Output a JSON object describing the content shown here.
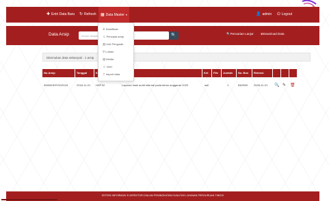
{
  "colors": {
    "brand": "#a31f1f",
    "search_button": "#3a4a5a",
    "delete_icon": "#c0392b"
  },
  "navbar": {
    "entry_label": "Entri Data Baru",
    "refresh_label": "Refresh",
    "master_label": "Data Master",
    "user_label": "admin",
    "logout_label": "Logout"
  },
  "dropdown": {
    "items": [
      {
        "label": "Klasifikasi",
        "icon": "sitemap-icon"
      },
      {
        "label": "Pencipta arsip",
        "icon": "user-icon"
      },
      {
        "label": "Unit Pengolah",
        "icon": "building-icon"
      },
      {
        "label": "Lokasi",
        "icon": "map-marker-icon"
      },
      {
        "label": "Media",
        "icon": "film-icon"
      },
      {
        "label": "User",
        "icon": "user-icon"
      },
      {
        "label": "Import data",
        "icon": "upload-icon"
      }
    ]
  },
  "search": {
    "title": "Data Arsip",
    "placeholder": "nomor arsip/ket",
    "advanced_label": "Pencarian Lanjut",
    "download_label": "Download Data"
  },
  "info": {
    "text": "Ditemukan data sebanyak : 1 arsip"
  },
  "table": {
    "columns": [
      "No.Arsip",
      "Tanggal",
      "Ko",
      "Ket",
      "File",
      "Jumlah",
      "No. Box",
      "Retensi"
    ],
    "rows": [
      {
        "no_arsip": "99/89/HKP/02/2018",
        "tanggal": "2018-11-01",
        "kode": "HKP.02",
        "uraian": "Laporan hasil audit internal pada tahun anggaran 2020",
        "ket": "asli",
        "file": "",
        "jumlah": "1",
        "no_box": "BA9900",
        "retensi": "2028-11-01"
      }
    ]
  },
  "footer": {
    "text": "SISTEM INFORMASI E-DIREKTORI DALAM PENINGKATAN KUALITAS LAYANAN PERGURUAN TINGGI"
  }
}
